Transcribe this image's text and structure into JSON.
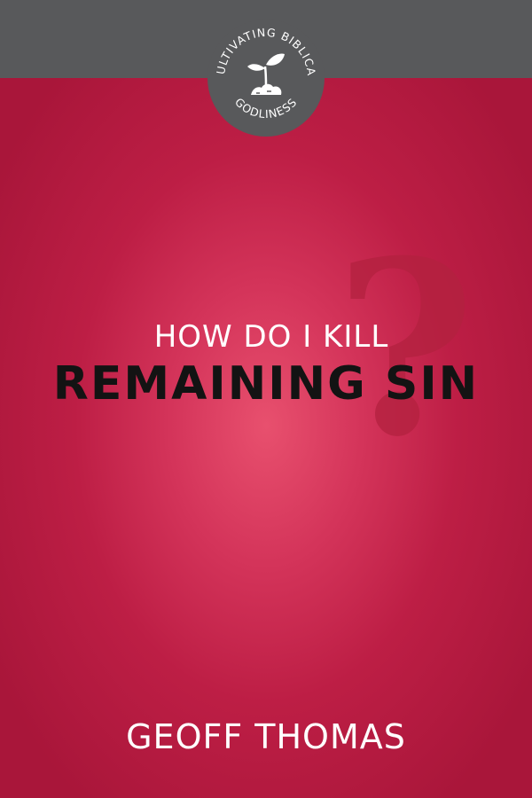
{
  "series": {
    "arc_top": "CULTIVATING BIBLICAL",
    "arc_bottom": "GODLINESS",
    "icon": "sprout-icon"
  },
  "book": {
    "title_prefix": "HOW DO I KILL",
    "title_main": "REMAINING SIN",
    "question_mark": "?",
    "author": "GEOFF THOMAS"
  },
  "colors": {
    "cover_red": "#c4224a",
    "top_band": "#58595b",
    "title_main": "#131313"
  }
}
